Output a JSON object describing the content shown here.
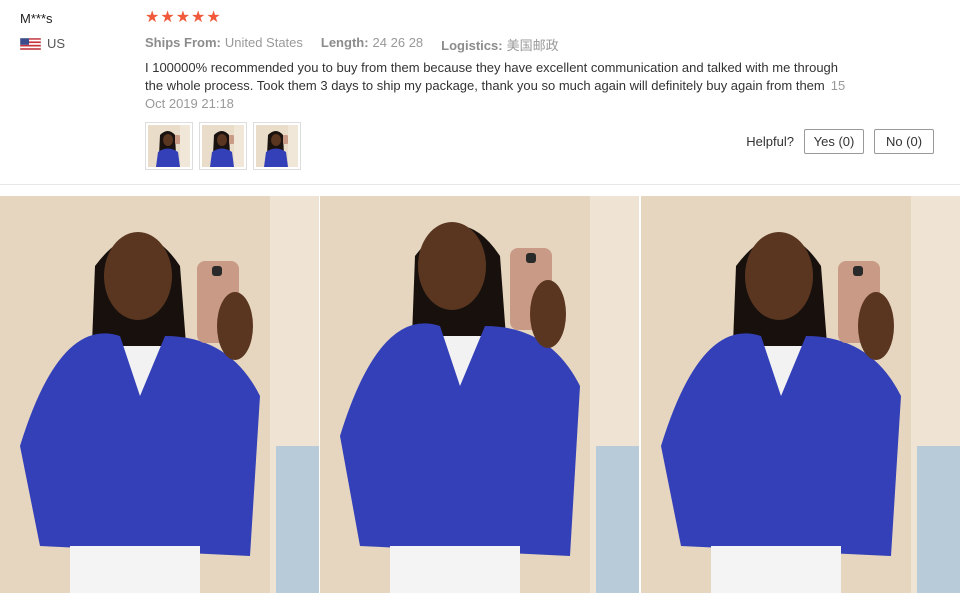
{
  "reviewer": {
    "name": "M***s",
    "country": "US",
    "flag_icon": "us-flag-icon"
  },
  "rating": {
    "stars": 5,
    "max": 5,
    "color": "#f05a3a"
  },
  "meta": {
    "ships_from_label": "Ships From:",
    "ships_from_value": "United States",
    "length_label": "Length:",
    "length_value": "24 26 28",
    "logistics_label": "Logistics:",
    "logistics_value": "美国邮政"
  },
  "review": {
    "text": "I 100000% recommended you to buy from them because they have excellent communication and talked with me through the whole process. Took them 3 days to ship my package, thank you so much again will definitely buy again from them",
    "date": "15 Oct 2019 21:18"
  },
  "thumbnails": [
    {
      "name": "review-photo-1"
    },
    {
      "name": "review-photo-2"
    },
    {
      "name": "review-photo-3"
    }
  ],
  "helpful": {
    "label": "Helpful?",
    "yes_label": "Yes (0)",
    "no_label": "No (0)"
  },
  "colors": {
    "jacket": "#3340b8",
    "wall": "#e8d9c4"
  }
}
